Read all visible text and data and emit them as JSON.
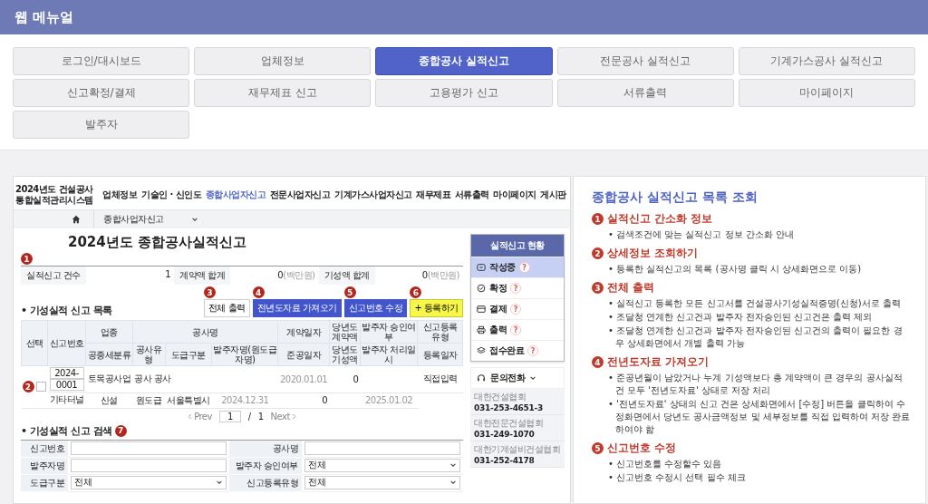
{
  "header": {
    "title": "웹 메뉴얼"
  },
  "menu": [
    {
      "label": "로그인/대시보드",
      "selected": false
    },
    {
      "label": "업체정보",
      "selected": false
    },
    {
      "label": "종합공사 실적신고",
      "selected": true
    },
    {
      "label": "전문공사 실적신고",
      "selected": false
    },
    {
      "label": "기계가스공사 실적신고",
      "selected": false
    },
    {
      "label": "신고확정/결제",
      "selected": false
    },
    {
      "label": "재무제표 신고",
      "selected": false
    },
    {
      "label": "고용평가 신고",
      "selected": false
    },
    {
      "label": "서류출력",
      "selected": false
    },
    {
      "label": "마이페이지",
      "selected": false
    },
    {
      "label": "발주자",
      "selected": false
    }
  ],
  "screenshot": {
    "logo_lines": [
      "2024년도 건설공사",
      "통합실적관리시스템"
    ],
    "nav": [
      {
        "label": "업체정보",
        "selected": false
      },
      {
        "label": "기술인 · 신인도",
        "selected": false
      },
      {
        "label": "종합사업자신고",
        "selected": true
      },
      {
        "label": "전문사업자신고",
        "selected": false
      },
      {
        "label": "기계가스사업자신고",
        "selected": false
      },
      {
        "label": "재무제표",
        "selected": false
      },
      {
        "label": "서류출력",
        "selected": false
      },
      {
        "label": "마이페이지",
        "selected": false
      },
      {
        "label": "게시판",
        "selected": false
      }
    ],
    "breadcrumb": "종합사업자신고",
    "page_title": "2024년도 종합공사실적신고",
    "summary_marker": "1",
    "summary": [
      {
        "label": "실적신고 건수",
        "value": "1"
      },
      {
        "label": "계약액 합계",
        "value": "0",
        "unit": "(백만원)"
      },
      {
        "label": "기성액 합계",
        "value": "0",
        "unit": "(백만원)"
      }
    ],
    "list_title": "• 기성실적 신고 목록",
    "buttons": [
      {
        "label": "전체 출력",
        "kind": "outline",
        "marker": "3"
      },
      {
        "label": "전년도자료 가져오기",
        "kind": "primary",
        "marker": "4"
      },
      {
        "label": "신고번호 수정",
        "kind": "primary",
        "marker": "5"
      },
      {
        "label": "+ 등록하기",
        "kind": "highlight",
        "marker": "6"
      }
    ],
    "table": {
      "select_header": "선택",
      "number_header": "신고번호",
      "group_header": "공사명",
      "top_headers": [
        "업종",
        "계약일자",
        "당년도 계약액",
        "발주자 승인여부",
        "신고등록유형"
      ],
      "bottom_headers": [
        "공종세분류",
        "공사유형",
        "도급구분",
        "발주자명(원도급자명)",
        "준공일자",
        "당년도 기성액",
        "발주자 처리일시",
        "등록일자"
      ],
      "rows": [
        {
          "marker": "2",
          "checked": false,
          "number": [
            "2024-",
            "0001"
          ],
          "top": {
            "industry": "토목공사업",
            "project": "공사 공사",
            "contract_date": "2020.01.01",
            "contract_amount": "0",
            "registration_type": "직접입력"
          },
          "bottom": {
            "work_type": "기타터널",
            "construction_type": "신설",
            "contract_kind": "원도급",
            "client": "서울특별시",
            "completion_date": "2024.12.31",
            "progress_amount": "0",
            "registered_date": "2025.01.02"
          }
        }
      ]
    },
    "pagination": {
      "prev": "Prev",
      "page": "1",
      "separator": "/",
      "total": "1",
      "next": "Next"
    },
    "search": {
      "title": "• 기성실적 신고 검색",
      "marker": "7",
      "fields": [
        {
          "label": "신고번호",
          "kind": "text"
        },
        {
          "label": "공사명",
          "kind": "text"
        },
        {
          "label": "발주자명",
          "kind": "text"
        },
        {
          "label": "발주자 승인여부",
          "kind": "select",
          "value": "전체"
        },
        {
          "label": "도급구분",
          "kind": "select",
          "value": "전체"
        },
        {
          "label": "신고등록유형",
          "kind": "select",
          "value": "전체"
        }
      ]
    },
    "sidebar": {
      "title": "실적신고 현황",
      "items": [
        {
          "label": "작성중",
          "badge": "?",
          "selected": true
        },
        {
          "label": "확정",
          "badge": "?",
          "selected": false
        },
        {
          "label": "결제",
          "badge": "?",
          "selected": false
        },
        {
          "label": "출력",
          "badge": "?",
          "selected": false
        },
        {
          "label": "접수완료",
          "badge": "?",
          "selected": false
        }
      ],
      "contact_label": "문의전화",
      "contacts": [
        {
          "org": "대한건설협회",
          "phone": "031-253-4651-3"
        },
        {
          "org": "대한전문건설협회",
          "phone": "031-249-1070"
        },
        {
          "org": "대한기계설비건설협회",
          "phone": "031-252-4178"
        }
      ]
    }
  },
  "guide": {
    "title": "종합공사 실적신고 목록 조회",
    "sections": [
      {
        "number": "1",
        "heading": "실적신고 간소화 정보",
        "bullets": [
          "• 검색조건에 맞는 실적신고 정보 간소화 안내"
        ]
      },
      {
        "number": "2",
        "heading": "상세정보 조회하기",
        "bullets": [
          "• 등록한 실적신고의 목록 (공사명 클릭 시 상세화면으로 이동)"
        ]
      },
      {
        "number": "3",
        "heading": "전체 출력",
        "bullets": [
          "• 실적신고 등록한 모든 신고서를 건설공사기성실적증명(신청)서로 출력",
          "• 조달청 연계한 신고건과 발주자 전자승인된 신고건은 출력 제외",
          "• 조달청 연계한 신고건과 발주자 전자승인된 신고건의 출력이 필요한 경우 상세화면에서 개별 출력 가능"
        ]
      },
      {
        "number": "4",
        "heading": "전년도자료 가져오기",
        "bullets": [
          "• 준공년월이 남았거나 누계 기성액보다 총 계약액이 큰 경우의 공사실적 건 모두 '전년도자료' 상태로 저장 처리",
          "• '전년도자료' 상태의 신고 건은 상세화면에서 [수정] 버튼을 클릭하여 수정화면에서 당년도 공사금액정보 및 세부정보를 직접 입력하여 저장 완료하여야 함"
        ]
      },
      {
        "number": "5",
        "heading": "신고번호 수정",
        "bullets": [
          "• 신고번호를 수정할수 있음",
          "• 신고번호 수정시 선택 필수 체크"
        ]
      }
    ]
  }
}
